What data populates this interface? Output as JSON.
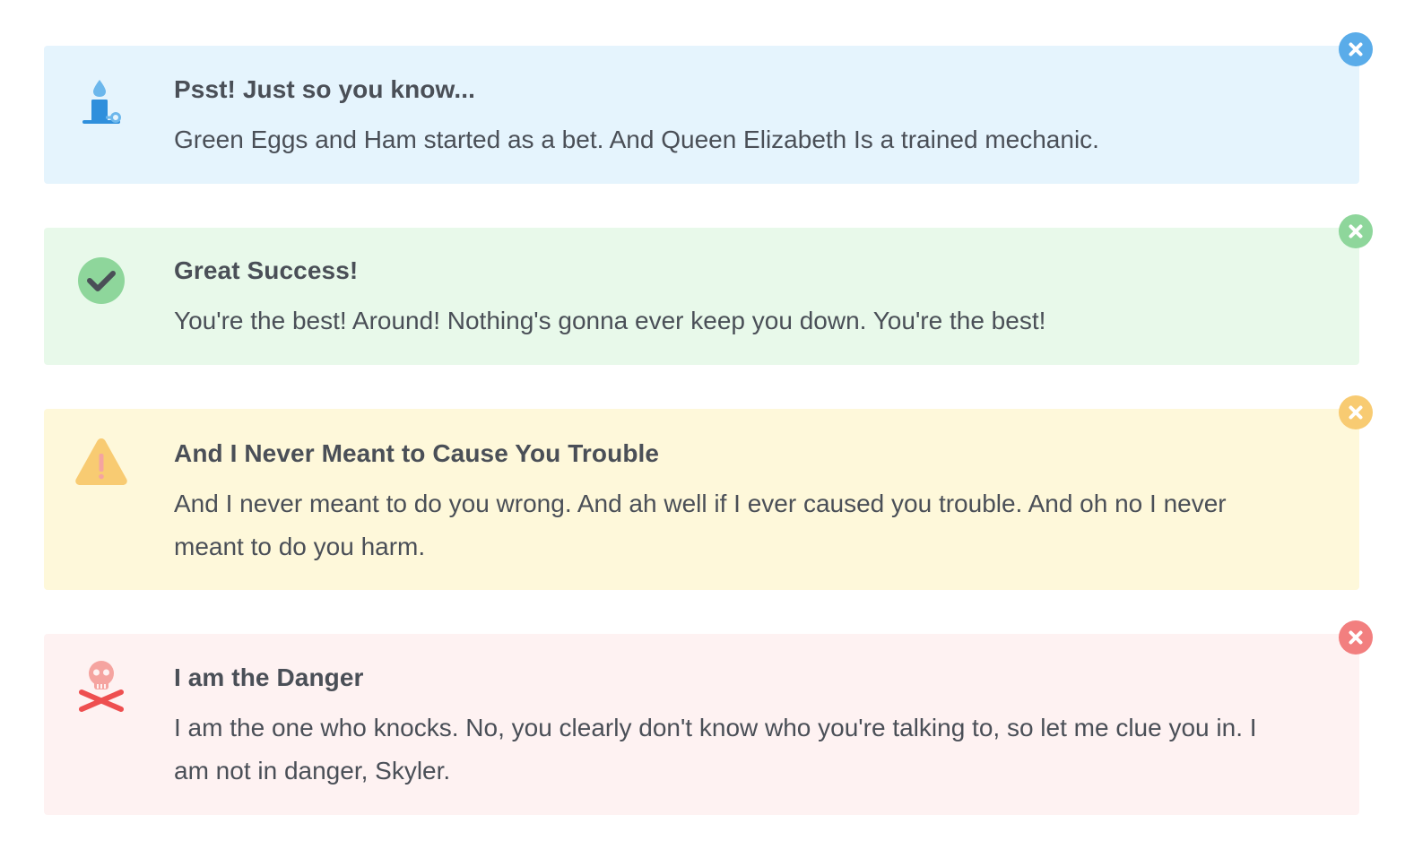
{
  "colors": {
    "info_bg": "#e5f4fd",
    "info_accent": "#5aace9",
    "success_bg": "#e8f9ea",
    "success_accent": "#8ed69b",
    "warning_bg": "#fef8da",
    "warning_accent": "#f8cb72",
    "danger_bg": "#fef2f2",
    "danger_accent": "#f27f7f",
    "text": "#4a4f57"
  },
  "alerts": [
    {
      "type": "info",
      "icon": "candle-icon",
      "title": "Psst! Just so you know...",
      "text": "Green Eggs and Ham started as a bet. And Queen Elizabeth Is a trained mechanic.",
      "close_icon": "close-icon"
    },
    {
      "type": "success",
      "icon": "checkmark-circle-icon",
      "title": "Great Success!",
      "text": "You're the best! Around! Nothing's gonna ever keep you down. You're the best!",
      "close_icon": "close-icon"
    },
    {
      "type": "warning",
      "icon": "warning-triangle-icon",
      "title": "And I Never Meant to Cause You Trouble",
      "text": "And I never meant to do you wrong. And ah well if I ever caused you trouble. And oh no I never meant to do you harm.",
      "close_icon": "close-icon"
    },
    {
      "type": "danger",
      "icon": "skull-crossbones-icon",
      "title": "I am the Danger",
      "text": "I am the one who knocks. No, you clearly don't know who you're talking to, so let me clue you in. I am not in danger, Skyler.",
      "close_icon": "close-icon"
    }
  ]
}
